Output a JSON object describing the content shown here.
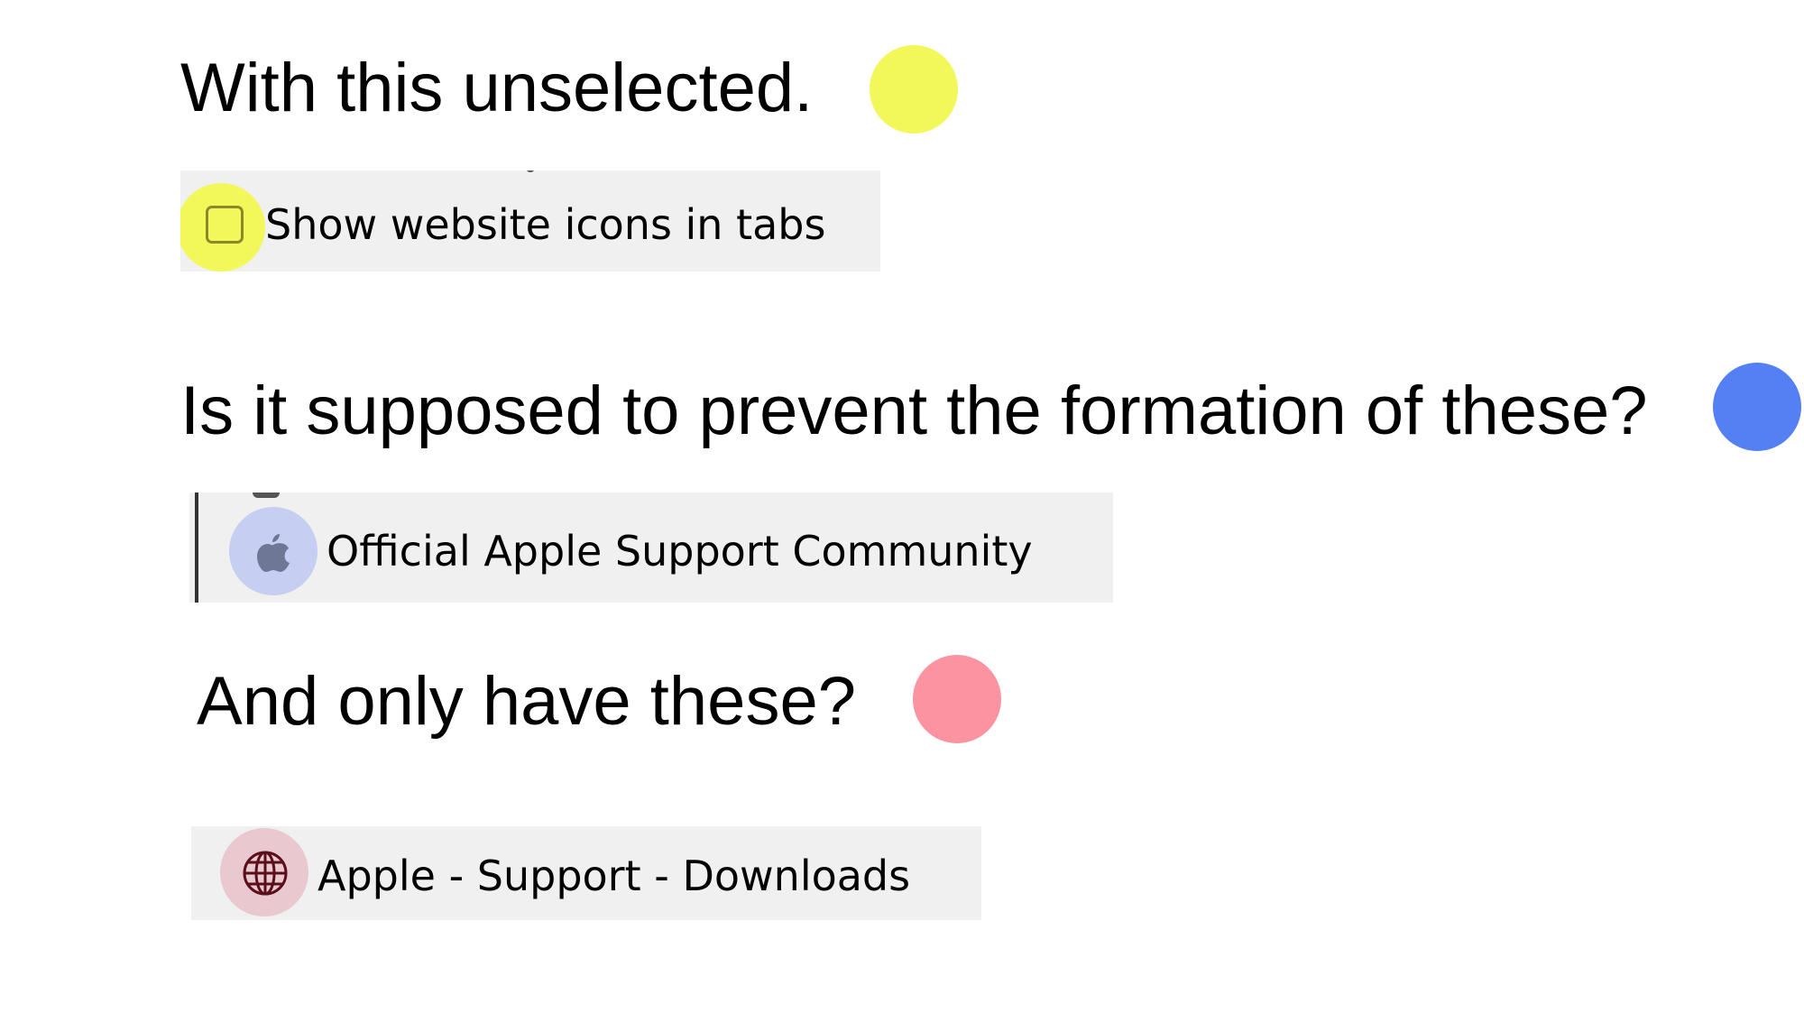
{
  "heading_1": "With this unselected.",
  "setting": {
    "checkbox_checked": false,
    "label": "Show website icons in tabs"
  },
  "heading_2": "Is it supposed to prevent the formation of these?",
  "tab_with_icon": {
    "icon": "apple-logo-icon",
    "title": "Official Apple Support Community"
  },
  "heading_3": "And only have these?",
  "tab_generic": {
    "icon": "globe-icon",
    "title": "Apple - Support - Downloads"
  },
  "colors": {
    "yellow_marker": "#f2f75a",
    "blue_marker": "#5580f4",
    "pink_marker": "#fb94a0",
    "panel_bg": "#f0f0f0"
  }
}
